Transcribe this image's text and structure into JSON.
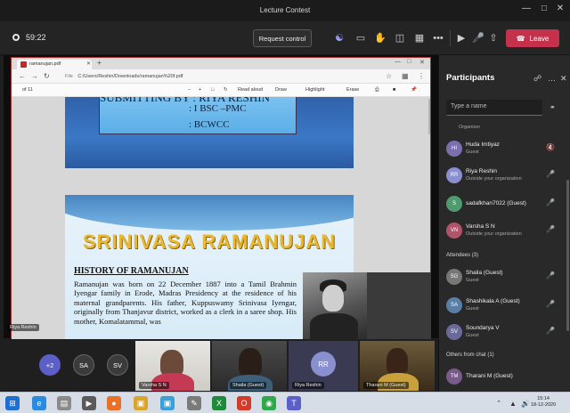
{
  "window": {
    "title": "Lecture Contest"
  },
  "toolbar": {
    "timer": "59:22",
    "request_control": "Request control",
    "leave": "Leave"
  },
  "browser": {
    "tab_label": "ramanujan.pdf",
    "address": "C:/Users/Reshin/Downloads/ramanujan%20f.pdf",
    "file_label": "File",
    "page_indicator": "of 11",
    "pdf_tools": [
      "Read aloud",
      "Draw",
      "Highlight",
      "Erase"
    ]
  },
  "slide1": {
    "submitting_by": "SUBMITTING BY : RIYA RESHIN",
    "class": ": I BSC –PMC",
    "college": ": BCWCC"
  },
  "slide2": {
    "title": "SRINIVASA RAMANUJAN",
    "heading": "HISTORY OF RAMANUJAN",
    "body": "Ramanujan was born on 22 December 1887 into a Tamil Brahmin Iyengar family in Erode, Madras Presidency at the residence of his maternal grandparents. His father, Kuppuswamy Srinivasa Iyengar, originally from Thanjavur district, worked as a clerk in a saree shop. His mother, Komalatammal, was"
  },
  "stage": {
    "presenter_tag": "Riya Reshin"
  },
  "tiles": {
    "overflow_count": "+2",
    "bubbles": [
      "SA",
      "SV"
    ],
    "video_names": [
      "Varsha S N",
      "Shaila (Guest)",
      "Riya Reshin",
      "Tharani M (Guest)"
    ],
    "riya_initials": "RR"
  },
  "participants": {
    "title": "Participants",
    "search_placeholder": "Type a name",
    "organizer_label": "Organizer",
    "people": [
      {
        "initials": "HI",
        "name": "Huda Imtiyaz",
        "sub": "Guest",
        "color": "#7b6fb0"
      },
      {
        "initials": "RR",
        "name": "Riya Reshin",
        "sub": "Outside your organization",
        "color": "#8a8fd0"
      },
      {
        "initials": "S",
        "name": "sadafkhan7022 (Guest)",
        "sub": "",
        "color": "#4f9a6e"
      },
      {
        "initials": "VN",
        "name": "Varsha S N",
        "sub": "Outside your organization",
        "color": "#b0546a"
      }
    ],
    "attendees_label": "Attendees (3)",
    "attendees": [
      {
        "initials": "SG",
        "name": "Shaila (Guest)",
        "sub": "Guest",
        "color": "#777"
      },
      {
        "initials": "SA",
        "name": "Shashikala A (Guest)",
        "sub": "Guest",
        "color": "#5a7fa6"
      },
      {
        "initials": "SV",
        "name": "Soundarya V",
        "sub": "Guest",
        "color": "#6a6a9a"
      }
    ],
    "others_label": "Others from chat (1)",
    "others": [
      {
        "initials": "TM",
        "name": "Tharani M (Guest)",
        "sub": "",
        "color": "#7a5a8a"
      }
    ]
  },
  "taskbar": {
    "time": "15:14",
    "date": "18-12-2020"
  },
  "colors": {
    "accent": "#6264a7",
    "leave": "#c4314b"
  }
}
